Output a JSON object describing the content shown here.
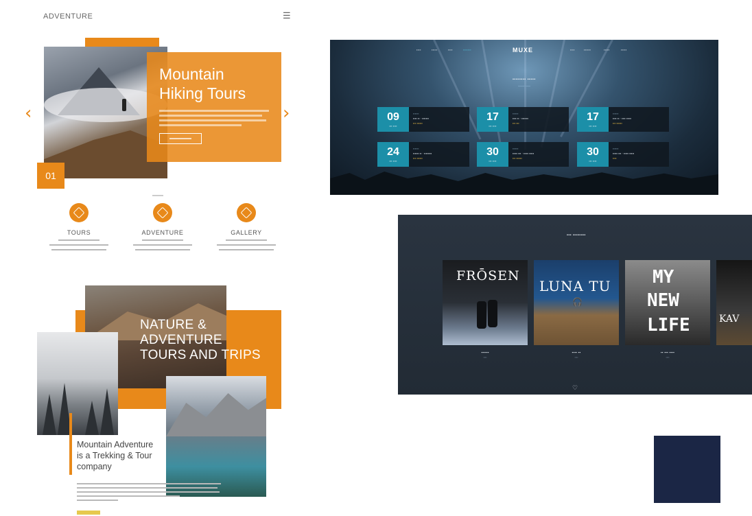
{
  "adventure": {
    "brand": "ADVENTURE",
    "menu_icon": "☰",
    "hero": {
      "title_line1": "Mountain",
      "title_line2": "Hiking Tours",
      "counter": "01",
      "arrow_left": "‹",
      "arrow_right": "›"
    },
    "features": [
      {
        "label": "TOURS",
        "icon": "tours-icon"
      },
      {
        "label": "ADVENTURE",
        "icon": "adventure-icon"
      },
      {
        "label": "GALLERY",
        "icon": "gallery-icon"
      }
    ],
    "nature": {
      "line1": "NATURE &",
      "line2": "ADVENTURE",
      "line3": "TOURS AND TRIPS"
    },
    "about": {
      "title_line1": "Mountain Adventure",
      "title_line2": "is a Trekking & Tour",
      "title_line3": "company"
    }
  },
  "tours": {
    "logo": "MUXE",
    "items": [
      {
        "day": "09"
      },
      {
        "day": "17"
      },
      {
        "day": "17"
      },
      {
        "day": "24"
      },
      {
        "day": "30"
      },
      {
        "day": "30"
      }
    ]
  },
  "releases": {
    "albums": [
      {
        "cover_text": "FRŌSEN",
        "icon": ""
      },
      {
        "cover_text": "LUNA TU",
        "icon": "headphones-icon"
      },
      {
        "cover_text_1": "MY",
        "cover_text_2": "NEW",
        "cover_text_3": "LIFE"
      },
      {
        "cover_text": "KAV"
      }
    ],
    "chevron": "♡"
  },
  "colors": {
    "accent": "#e8891a",
    "tour_date": "#1c8fa8",
    "swatch": "#1b2645"
  }
}
